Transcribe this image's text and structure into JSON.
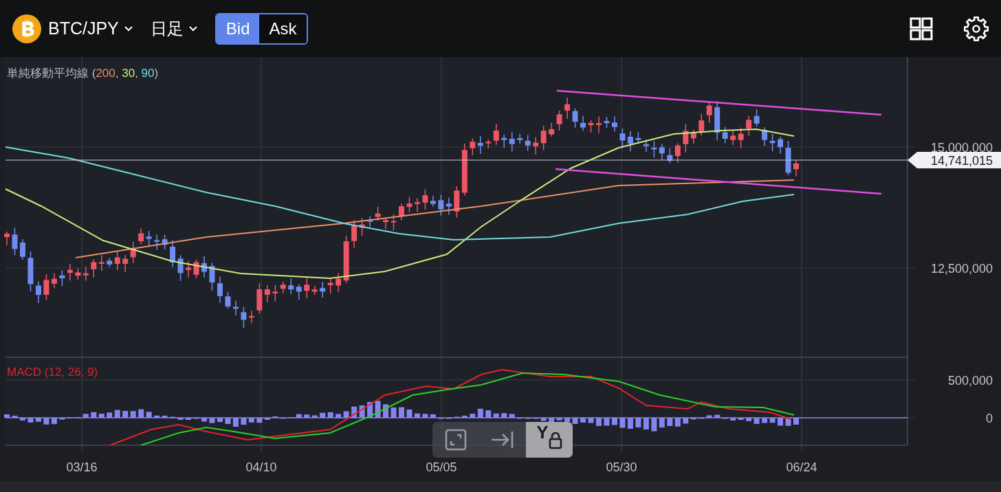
{
  "header": {
    "symbol": "BTC/JPY",
    "timeframe": "日足",
    "price_toggle": [
      {
        "label": "Bid",
        "selected": true
      },
      {
        "label": "Ask",
        "selected": false
      }
    ]
  },
  "chart": {
    "indicator_legend": {
      "prefix": "単純移動平均線 (",
      "separator": ", ",
      "suffix": ")",
      "periods": [
        {
          "value": "200",
          "color": "#e8906a"
        },
        {
          "value": "30",
          "color": "#c8ec7c"
        },
        {
          "value": "90",
          "color": "#72dcdc"
        }
      ]
    },
    "price_axis": [
      "15,000,000",
      "12,500,000"
    ],
    "last_price": "14,741,015",
    "macd_legend": "MACD (12, 26, 9)",
    "macd_axis": [
      "500,000",
      "0"
    ],
    "date_axis": [
      "03/16",
      "04/10",
      "05/05",
      "05/30",
      "06/24"
    ]
  },
  "toolbar": [
    {
      "kind": "fit",
      "selected": false
    },
    {
      "kind": "scroll-end",
      "selected": false
    },
    {
      "kind": "y-lock",
      "label": "Y",
      "selected": true
    }
  ]
}
